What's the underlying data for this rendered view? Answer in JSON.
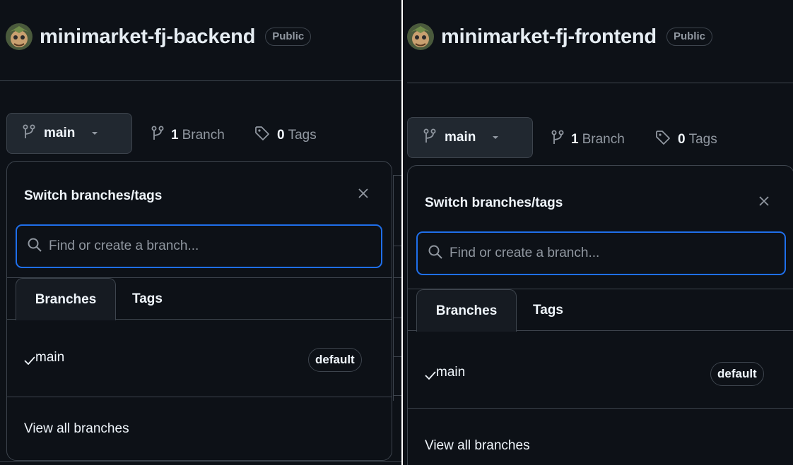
{
  "panels": [
    {
      "repo_name": "minimarket-fj-backend",
      "visibility": "Public",
      "current_branch": "main",
      "branch_count": "1",
      "branch_label": "Branch",
      "tag_count": "0",
      "tag_label": "Tags",
      "dropdown": {
        "title": "Switch branches/tags",
        "search_placeholder": "Find or create a branch...",
        "tabs": [
          "Branches",
          "Tags"
        ],
        "branches": [
          {
            "name": "main",
            "badge": "default",
            "selected": true
          }
        ],
        "footer_link": "View all branches"
      }
    },
    {
      "repo_name": "minimarket-fj-frontend",
      "visibility": "Public",
      "current_branch": "main",
      "branch_count": "1",
      "branch_label": "Branch",
      "tag_count": "0",
      "tag_label": "Tags",
      "dropdown": {
        "title": "Switch branches/tags",
        "search_placeholder": "Find or create a branch...",
        "tabs": [
          "Branches",
          "Tags"
        ],
        "branches": [
          {
            "name": "main",
            "badge": "default",
            "selected": true
          }
        ],
        "footer_link": "View all branches"
      }
    }
  ],
  "colors": {
    "background": "#0d1117",
    "border": "#3d444d",
    "focus_ring": "#1f6feb",
    "muted_text": "#9198a1",
    "text": "#f0f6fc"
  },
  "icons": [
    "avatar",
    "git-branch-icon",
    "chevron-down-icon",
    "tag-icon",
    "close-icon",
    "search-icon",
    "check-icon"
  ]
}
